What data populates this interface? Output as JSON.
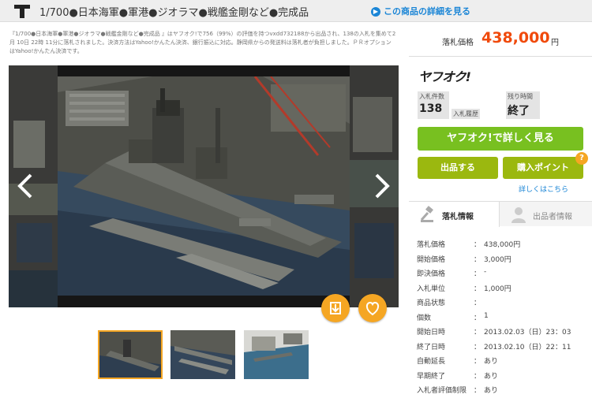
{
  "header": {
    "title": "1/700●日本海軍●軍港●ジオラマ●戦艦金剛など●完成品",
    "detail_link": "この商品の詳細を見る"
  },
  "description": "『1/700●日本海軍●軍港●ジオラマ●戦艦金剛など●完成品 』はヤフオク!で756（99%）の評価を持つvxdd732188から出品され、138の入札を集めて2月 10日 22時 11分に落札されました。決済方法はYahoo!かんたん決済、銀行振込に対応。静岡県からの発送料は落札者が負担しました。ＰＲオプションはYahoo!かんたん決済です。",
  "price": {
    "label": "落札価格",
    "value": "438,000",
    "unit": "円"
  },
  "logo": "ヤフオク!",
  "stats": {
    "bids_label": "入札件数",
    "bids_value": "138",
    "history_label": "入札履歴",
    "remaining_label": "残り時間",
    "remaining_value": "終了"
  },
  "buttons": {
    "view_more": "ヤフオク!で詳しく見る",
    "sell": "出品する",
    "points": "購入ポイント",
    "help_mark": "?",
    "help_link": "詳しくはこちら"
  },
  "tabs": {
    "bid_info": "落札情報",
    "seller_info": "出品者情報"
  },
  "info_rows": [
    {
      "k": "落札価格",
      "v": "438,000円"
    },
    {
      "k": "開始価格",
      "v": "3,000円"
    },
    {
      "k": "即決価格",
      "v": "-"
    },
    {
      "k": "入札単位",
      "v": "1,000円"
    },
    {
      "k": "商品状態",
      "v": ""
    },
    {
      "k": "個数",
      "v": "1"
    },
    {
      "k": "開始日時",
      "v": "2013.02.03（日）23：03"
    },
    {
      "k": "終了日時",
      "v": "2013.02.10（日）22：11"
    },
    {
      "k": "自動延長",
      "v": "あり"
    },
    {
      "k": "早期終了",
      "v": "あり"
    },
    {
      "k": "入札者評価制限",
      "v": "あり"
    }
  ],
  "colon": "：",
  "colors": {
    "accent_orange": "#f5a623",
    "price_red": "#f04a0c",
    "green": "#78c020",
    "olive": "#9bb80f",
    "link_blue": "#1a85d6"
  }
}
